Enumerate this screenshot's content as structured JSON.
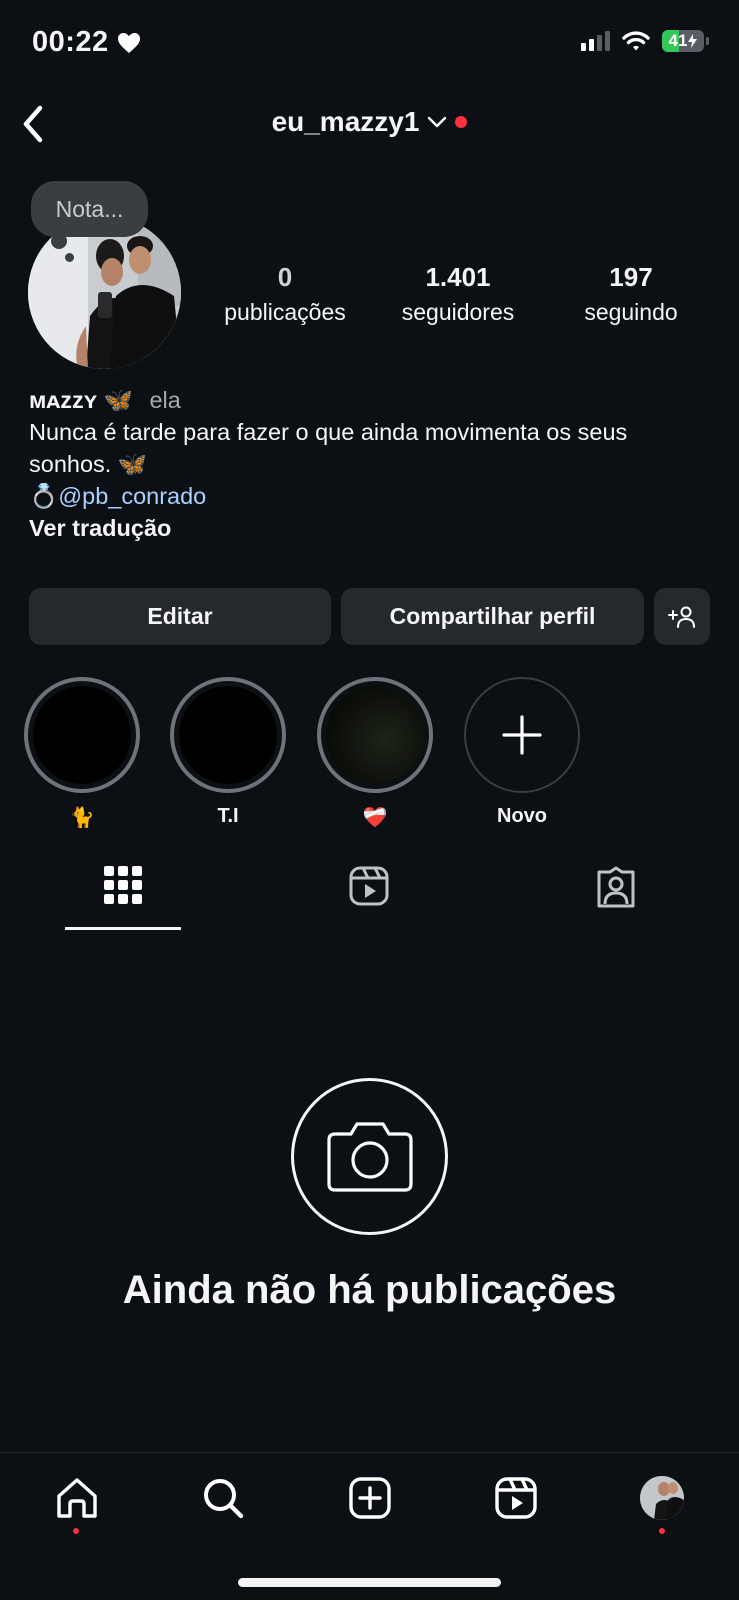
{
  "status_bar": {
    "time": "00:22",
    "battery_level": "41",
    "battery_fraction": 0.41,
    "icons": [
      "heart-icon",
      "signal-icon",
      "wifi-icon",
      "battery-charging-icon"
    ]
  },
  "header": {
    "username": "eu_mazzy1",
    "icons": [
      "back-icon",
      "chevron-down-icon"
    ]
  },
  "note": {
    "placeholder": "Nota..."
  },
  "stats": {
    "posts_count": "0",
    "posts_label": "publicações",
    "followers_count": "1.401",
    "followers_label": "seguidores",
    "following_count": "197",
    "following_label": "seguindo"
  },
  "bio": {
    "display_name": "ᴍᴀᴢᴢʏ",
    "display_emoji": "🦋",
    "pronoun": "ela",
    "text_line1": "Nunca é tarde para fazer o que ainda movimenta os seus",
    "text_line2": "sonhos.",
    "text_emoji": "🦋",
    "ring_emoji": "💍",
    "mention": "@pb_conrado",
    "translate_label": "Ver tradução"
  },
  "actions": {
    "edit_label": "Editar",
    "share_label": "Compartilhar perfil",
    "add_person_icon": "add-person-icon"
  },
  "highlights": [
    {
      "label": "🐈"
    },
    {
      "label": "T.I"
    },
    {
      "label": "❤️‍🩹"
    },
    {
      "label": "Novo"
    }
  ],
  "tabs": [
    "grid-icon",
    "reels-icon",
    "tagged-icon"
  ],
  "empty_state": {
    "title": "Ainda não há publicações",
    "icon": "camera-icon"
  },
  "bottom_nav": [
    "home-icon",
    "search-icon",
    "create-icon",
    "reels-icon",
    "profile-avatar"
  ],
  "colors": {
    "background": "#0c1015",
    "button": "#25292e",
    "notification_dot": "#ff3040",
    "mention": "#a8d1ff",
    "battery": "#34c759"
  }
}
